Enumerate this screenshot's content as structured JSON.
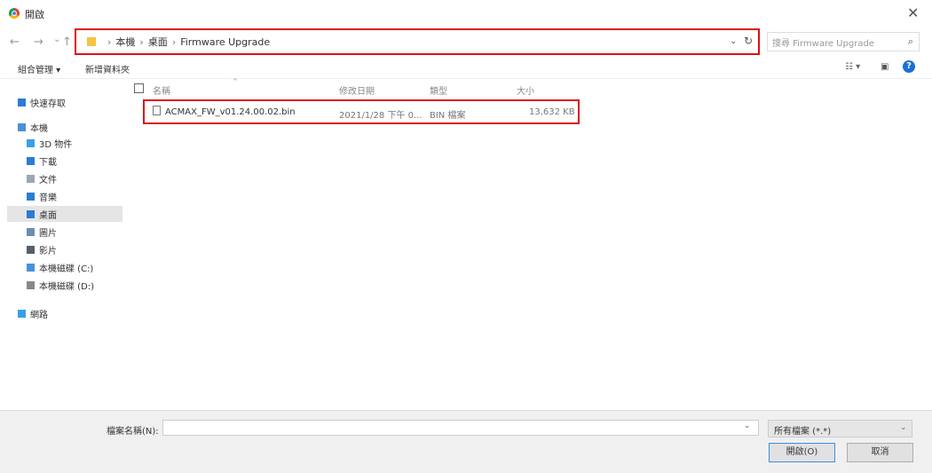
{
  "window": {
    "title": "開啟"
  },
  "nav": {
    "back": "←",
    "forward": "→",
    "recent": "⌄",
    "up": "↑"
  },
  "address": {
    "crumbs": [
      "本機",
      "桌面",
      "Firmware Upgrade"
    ],
    "separator": "›",
    "dropdown": "⌄",
    "refresh": "↻"
  },
  "search": {
    "placeholder": "搜尋 Firmware Upgrade",
    "icon": "⌕"
  },
  "toolbar": {
    "organize": "組合管理 ▾",
    "new_folder": "新增資料夾",
    "view": "☷ ▾",
    "preview": "▣",
    "help": "?"
  },
  "sidebar": {
    "items": [
      {
        "label": "快速存取",
        "icon": "star-icon",
        "color": "#2b7cd3"
      },
      {
        "label": "本機",
        "icon": "computer-icon",
        "color": "#4a90d9"
      },
      {
        "label": "3D 物件",
        "icon": "cube-icon",
        "color": "#3aa0e8"
      },
      {
        "label": "下載",
        "icon": "download-icon",
        "color": "#2b7cd3"
      },
      {
        "label": "文件",
        "icon": "document-icon",
        "color": "#9aa7b4"
      },
      {
        "label": "音樂",
        "icon": "music-icon",
        "color": "#2b7cd3"
      },
      {
        "label": "桌面",
        "icon": "desktop-icon",
        "color": "#2b7cd3"
      },
      {
        "label": "圖片",
        "icon": "picture-icon",
        "color": "#6b8fb0"
      },
      {
        "label": "影片",
        "icon": "video-icon",
        "color": "#55606b"
      },
      {
        "label": "本機磁碟 (C:)",
        "icon": "drive-c-icon",
        "color": "#4a90d9"
      },
      {
        "label": "本機磁碟 (D:)",
        "icon": "drive-d-icon",
        "color": "#888888"
      },
      {
        "label": "網路",
        "icon": "network-icon",
        "color": "#3aa0e8"
      }
    ]
  },
  "columns": {
    "name": "名稱",
    "date": "修改日期",
    "type": "類型",
    "size": "大小",
    "sort": "^"
  },
  "files": [
    {
      "name": "ACMAX_FW_v01.24.00.02.bin",
      "date": "2021/1/28 下午 0...",
      "type": "BIN 檔案",
      "size": "13,632 KB"
    }
  ],
  "bottom": {
    "filename_label": "檔案名稱(N):",
    "filename_value": "",
    "filename_caret": "⌄",
    "filter": "所有檔案 (*.*)",
    "filter_caret": "⌄",
    "open": "開啟(O)",
    "cancel": "取消"
  },
  "highlight_color": "#dd1111"
}
